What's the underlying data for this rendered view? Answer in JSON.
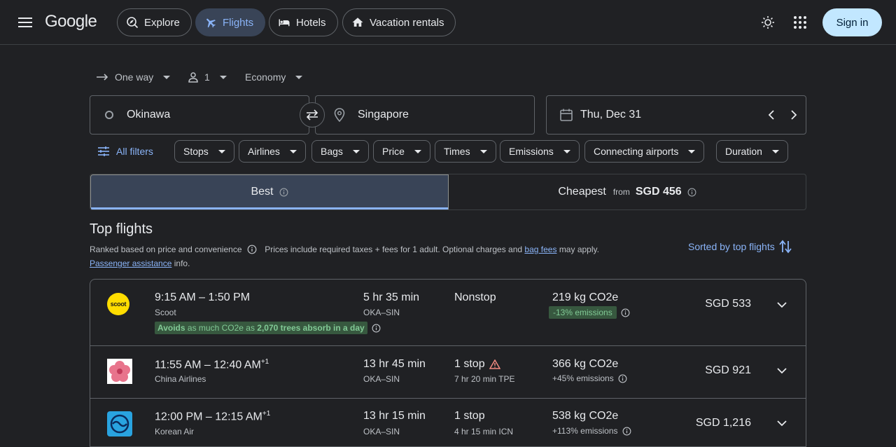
{
  "header": {
    "logo_text": "Google",
    "tabs": [
      {
        "label": "Explore",
        "icon": "explore-icon"
      },
      {
        "label": "Flights",
        "icon": "flight-icon",
        "active": true
      },
      {
        "label": "Hotels",
        "icon": "bed-icon"
      },
      {
        "label": "Vacation rentals",
        "icon": "house-icon"
      }
    ],
    "signin_label": "Sign in"
  },
  "trip": {
    "type": "One way",
    "passengers": "1",
    "cabin": "Economy",
    "origin": "Okinawa",
    "destination": "Singapore",
    "date": "Thu, Dec 31"
  },
  "filters": {
    "all_label": "All filters",
    "chips": [
      "Stops",
      "Airlines",
      "Bags",
      "Price",
      "Times",
      "Emissions",
      "Connecting airports",
      "Duration"
    ]
  },
  "sort_tabs": {
    "best_label": "Best",
    "cheapest_label": "Cheapest",
    "from_label": "from",
    "cheapest_price": "SGD 456"
  },
  "results": {
    "title": "Top flights",
    "ranked_text": "Ranked based on price and convenience",
    "prices_text": "Prices include required taxes + fees for 1 adult. Optional charges and",
    "bag_fees_link": "bag fees",
    "may_apply": "may apply.",
    "assistance_link": "Passenger assistance",
    "info_text": "info.",
    "sorted_label": "Sorted by top flights"
  },
  "flights": [
    {
      "times": "9:15 AM – 1:50 PM",
      "plus_day": "",
      "airline": "Scoot",
      "duration": "5 hr 35 min",
      "route": "OKA–SIN",
      "stops": "Nonstop",
      "layover": "",
      "co2": "219 kg CO2e",
      "emissions": "-13% emissions",
      "avoid_prefix": "Avoids",
      "avoid_middle": "as much CO2e as",
      "avoid_trees": "2,070 trees absorb in a day",
      "price": "SGD 533",
      "logo": "scoot-logo",
      "logo_text": "scoot"
    },
    {
      "times": "11:55 AM – 12:40 AM",
      "plus_day": "+1",
      "airline": "China Airlines",
      "duration": "13 hr 45 min",
      "route": "OKA–SIN",
      "stops": "1 stop",
      "layover": "7 hr 20 min TPE",
      "co2": "366 kg CO2e",
      "emissions": "+45% emissions",
      "price": "SGD 921",
      "logo": "china-airlines-logo"
    },
    {
      "times": "12:00 PM – 12:15 AM",
      "plus_day": "+1",
      "airline": "Korean Air",
      "duration": "13 hr 15 min",
      "route": "OKA–SIN",
      "stops": "1 stop",
      "layover": "4 hr 15 min ICN",
      "co2": "538 kg CO2e",
      "emissions": "+113% emissions",
      "price": "SGD 1,216",
      "logo": "korean-air-logo"
    }
  ],
  "colors": {
    "background": "#202124",
    "accent": "#8ab4f8",
    "active_tab": "#394457",
    "signin": "#c2e7ff",
    "emission_good": "#81c995"
  }
}
